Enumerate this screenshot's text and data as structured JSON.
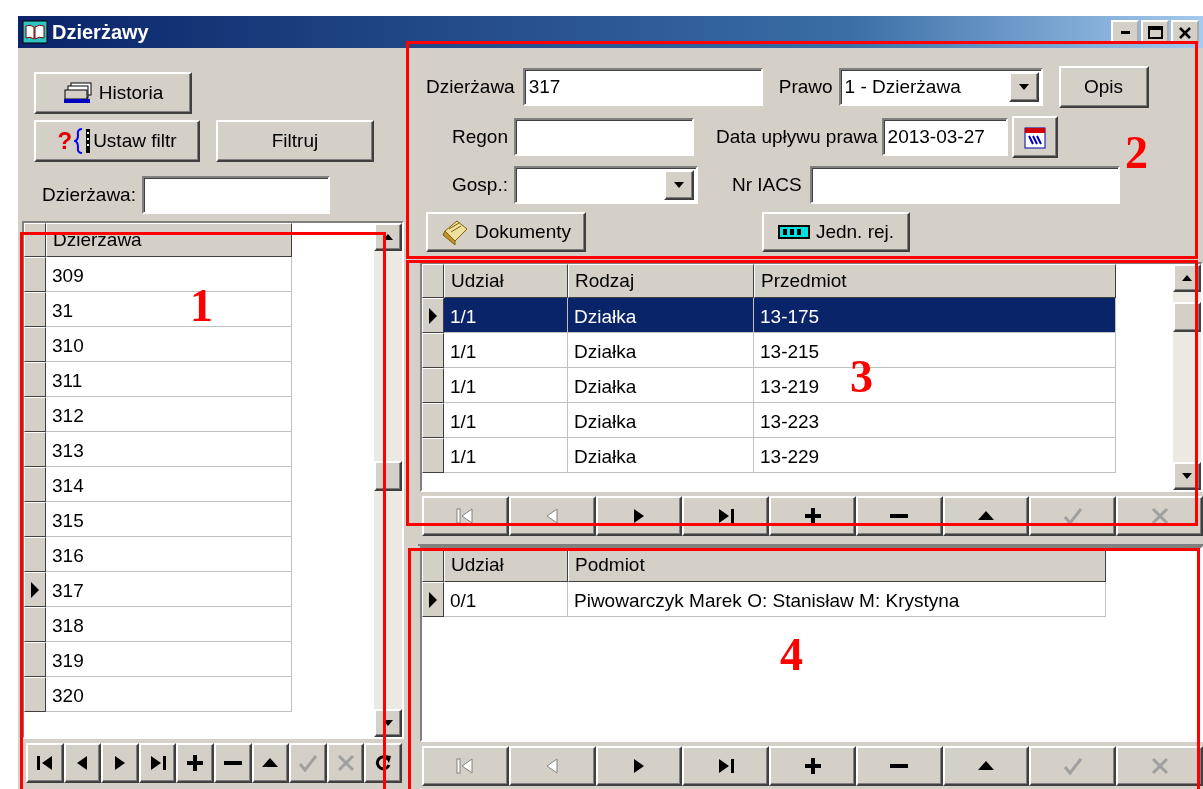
{
  "window": {
    "title": "Dzierżawy"
  },
  "filter_panel": {
    "history_button": "Historia",
    "set_filter_mark": "?",
    "set_filter_button": "Ustaw filtr",
    "filter_button": "Filtruj",
    "search": {
      "label": "Dzierżawa:"
    }
  },
  "lease_grid": {
    "callout": "1",
    "columns": [
      "Dzierżawa"
    ],
    "rows": [
      {
        "cells": [
          "309"
        ],
        "current": false,
        "selected": false
      },
      {
        "cells": [
          "31"
        ],
        "current": false,
        "selected": false
      },
      {
        "cells": [
          "310"
        ],
        "current": false,
        "selected": false
      },
      {
        "cells": [
          "311"
        ],
        "current": false,
        "selected": false
      },
      {
        "cells": [
          "312"
        ],
        "current": false,
        "selected": false
      },
      {
        "cells": [
          "313"
        ],
        "current": false,
        "selected": false
      },
      {
        "cells": [
          "314"
        ],
        "current": false,
        "selected": false
      },
      {
        "cells": [
          "315"
        ],
        "current": false,
        "selected": false
      },
      {
        "cells": [
          "316"
        ],
        "current": false,
        "selected": false
      },
      {
        "cells": [
          "317"
        ],
        "current": true,
        "selected": false
      },
      {
        "cells": [
          "318"
        ],
        "current": false,
        "selected": false
      },
      {
        "cells": [
          "319"
        ],
        "current": false,
        "selected": false
      },
      {
        "cells": [
          "320"
        ],
        "current": false,
        "selected": false
      }
    ],
    "navigator": [
      {
        "kind": "first",
        "disabled": false
      },
      {
        "kind": "prior",
        "disabled": false
      },
      {
        "kind": "next",
        "disabled": false
      },
      {
        "kind": "last",
        "disabled": false
      },
      {
        "kind": "insert",
        "disabled": false
      },
      {
        "kind": "delete",
        "disabled": false
      },
      {
        "kind": "edit",
        "disabled": false
      },
      {
        "kind": "post",
        "disabled": true
      },
      {
        "kind": "cancel",
        "disabled": true
      },
      {
        "kind": "refresh",
        "disabled": false
      }
    ]
  },
  "lease_form": {
    "callout": "2",
    "lease": {
      "label": "Dzierżawa",
      "value": "317"
    },
    "right": {
      "label": "Prawo",
      "value": "1 - Dzierżawa"
    },
    "description_button": "Opis",
    "regon": {
      "label": "Regon"
    },
    "expiry_date": {
      "label": "Data upływu prawa",
      "value": "2013-03-27"
    },
    "farm": {
      "label": "Gosp.:"
    },
    "iacs": {
      "label": "Nr IACS"
    },
    "documents_button": "Dokumenty",
    "units_button": "Jedn. rej."
  },
  "parcels_grid": {
    "callout": "3",
    "columns": [
      "Udział",
      "Rodzaj",
      "Przedmiot"
    ],
    "rows": [
      {
        "cells": [
          "1/1",
          "Działka",
          "13-175"
        ],
        "current": true,
        "selected": true
      },
      {
        "cells": [
          "1/1",
          "Działka",
          "13-215"
        ],
        "current": false,
        "selected": false
      },
      {
        "cells": [
          "1/1",
          "Działka",
          "13-219"
        ],
        "current": false,
        "selected": false
      },
      {
        "cells": [
          "1/1",
          "Działka",
          "13-223"
        ],
        "current": false,
        "selected": false
      },
      {
        "cells": [
          "1/1",
          "Działka",
          "13-229"
        ],
        "current": false,
        "selected": false
      }
    ],
    "navigator": [
      {
        "kind": "first",
        "disabled": true
      },
      {
        "kind": "prior",
        "disabled": true
      },
      {
        "kind": "next",
        "disabled": false
      },
      {
        "kind": "last",
        "disabled": false
      },
      {
        "kind": "insert",
        "disabled": false
      },
      {
        "kind": "delete",
        "disabled": false
      },
      {
        "kind": "edit",
        "disabled": false
      },
      {
        "kind": "post",
        "disabled": true
      },
      {
        "kind": "cancel",
        "disabled": true
      }
    ]
  },
  "subjects_grid": {
    "callout": "4",
    "columns": [
      "Udział",
      "Podmiot"
    ],
    "rows": [
      {
        "cells": [
          "0/1",
          "Piwowarczyk Marek O: Stanisław M: Krystyna"
        ],
        "current": true,
        "selected": false
      }
    ],
    "navigator": [
      {
        "kind": "first",
        "disabled": true
      },
      {
        "kind": "prior",
        "disabled": true
      },
      {
        "kind": "next",
        "disabled": false
      },
      {
        "kind": "last",
        "disabled": false
      },
      {
        "kind": "insert",
        "disabled": false
      },
      {
        "kind": "delete",
        "disabled": false
      },
      {
        "kind": "edit",
        "disabled": false
      },
      {
        "kind": "post",
        "disabled": true
      },
      {
        "kind": "cancel",
        "disabled": true
      }
    ]
  }
}
